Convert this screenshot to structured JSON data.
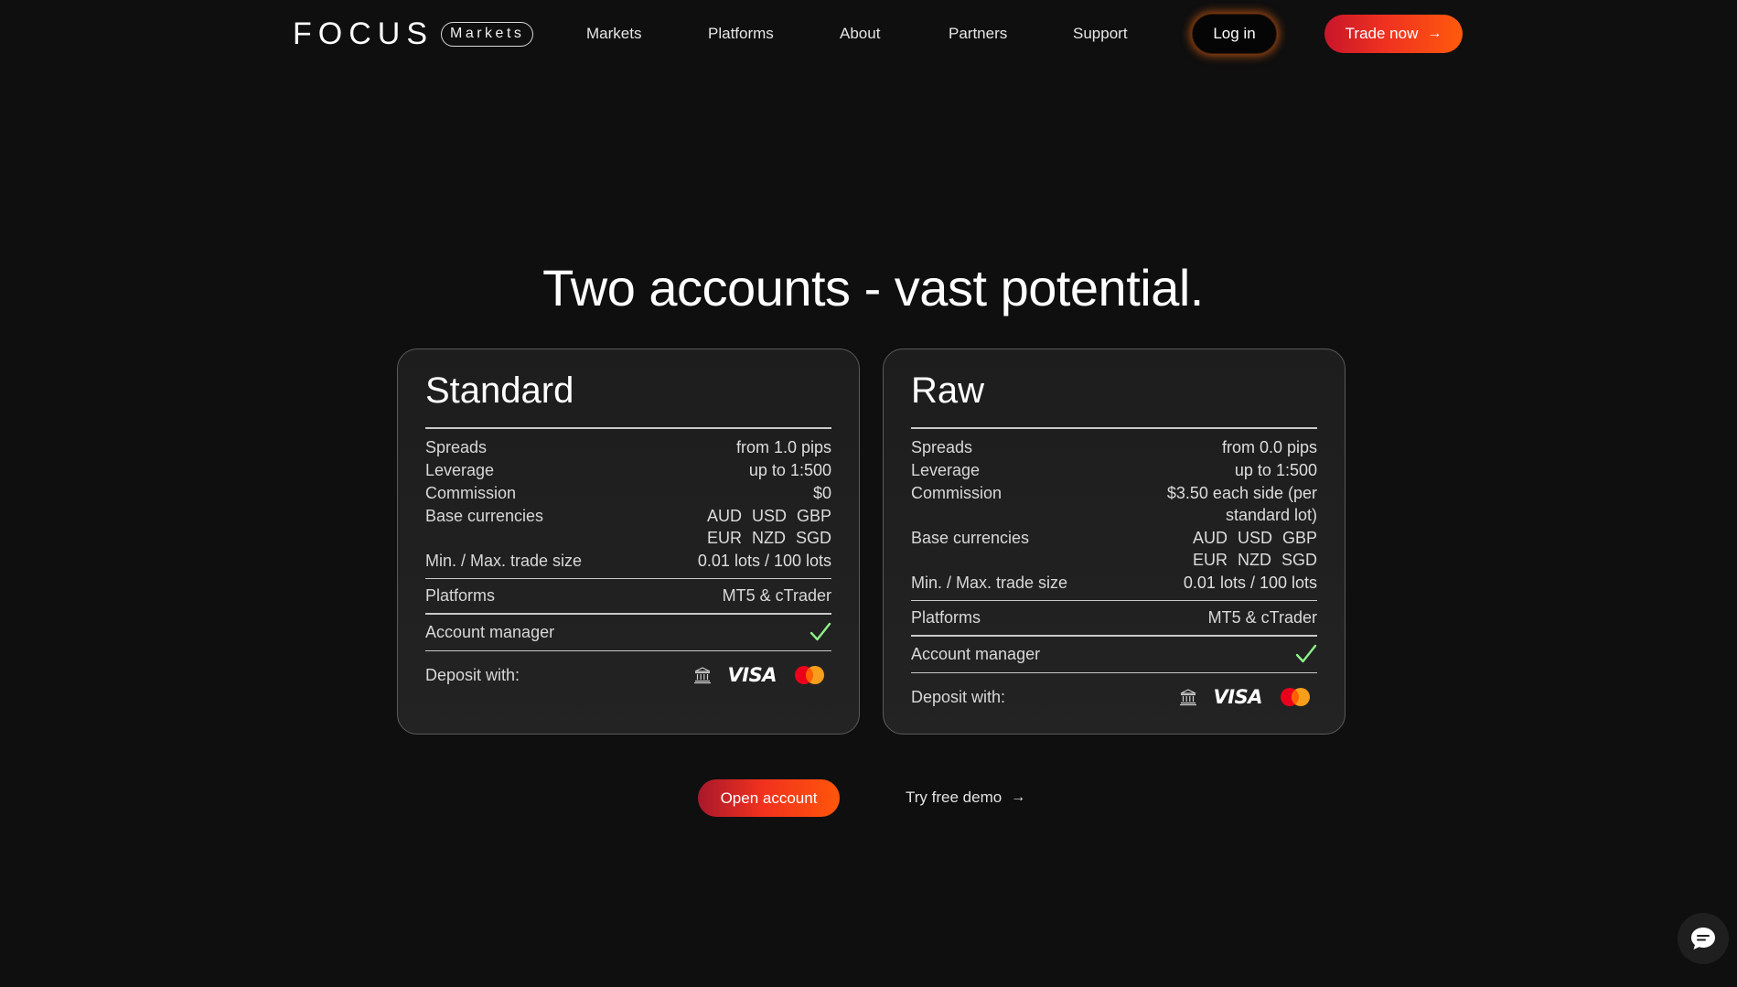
{
  "header": {
    "logo_word": "FOCUS",
    "logo_pill": "Markets",
    "nav": [
      "Markets",
      "Platforms",
      "About",
      "Partners",
      "Support"
    ],
    "login_label": "Log in",
    "trade_label": "Trade now"
  },
  "hero": {
    "title": "Two accounts - vast potential."
  },
  "cards": [
    {
      "title": "Standard",
      "spreads_label": "Spreads",
      "spreads": "from 1.0 pips",
      "leverage_label": "Leverage",
      "leverage": "up to 1:500",
      "commission_label": "Commission",
      "commission": "$0",
      "commission_line2": "",
      "currencies_label": "Base currencies",
      "currencies_line1": "AUD USD GBP",
      "currencies_line2": "EUR NZD SGD",
      "trade_size_label": "Min. / Max. trade size",
      "trade_size": "0.01 lots / 100 lots",
      "platforms_label": "Platforms",
      "platforms": "MT5 & cTrader",
      "manager_label": "Account manager",
      "deposit_label": "Deposit with:",
      "visa_text": "VISA"
    },
    {
      "title": "Raw",
      "spreads_label": "Spreads",
      "spreads": "from 0.0 pips",
      "leverage_label": "Leverage",
      "leverage": "up to 1:500",
      "commission_label": "Commission",
      "commission": "$3.50 each side (per",
      "commission_line2": "standard lot)",
      "currencies_label": "Base currencies",
      "currencies_line1": "AUD USD GBP",
      "currencies_line2": "EUR NZD SGD",
      "trade_size_label": "Min. / Max. trade size",
      "trade_size": "0.01 lots / 100 lots",
      "platforms_label": "Platforms",
      "platforms": "MT5 & cTrader",
      "manager_label": "Account manager",
      "deposit_label": "Deposit with:",
      "visa_text": "VISA"
    }
  ],
  "cta": {
    "open_label": "Open account",
    "demo_label": "Try free demo"
  },
  "icons": {
    "arrow": "arrow-right-icon",
    "check": "checkmark-icon",
    "bank": "bank-icon",
    "visa": "visa-icon",
    "mastercard": "mastercard-icon",
    "chat": "chat-bubble-icon"
  },
  "colors": {
    "background": "#0f0f0f",
    "accent_red": "#f0321f",
    "accent_orange": "#ff5a0d",
    "check_green": "#8ff08a"
  }
}
